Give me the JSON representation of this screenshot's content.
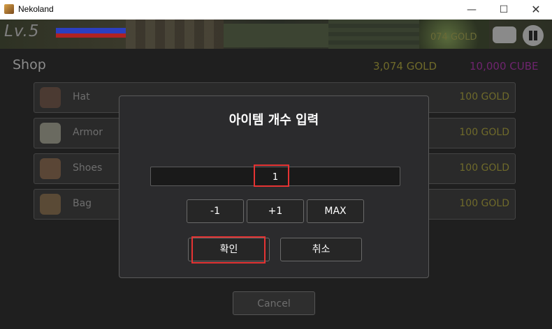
{
  "window": {
    "title": "Nekoland",
    "minimize": "—",
    "maximize": "☐",
    "close": "✕"
  },
  "hud": {
    "level": "Lv.5",
    "gold_partial": "074 GOLD"
  },
  "shop": {
    "title": "Shop",
    "gold": "3,074 GOLD",
    "cube": "10,000 CUBE",
    "items": [
      {
        "name": "Hat",
        "price": "100 GOLD",
        "icon": "hat-icon"
      },
      {
        "name": "Armor",
        "price": "100 GOLD",
        "icon": "armor-icon"
      },
      {
        "name": "Shoes",
        "price": "100 GOLD",
        "icon": "shoes-icon"
      },
      {
        "name": "Bag",
        "price": "100 GOLD",
        "icon": "bag-icon"
      }
    ],
    "cancel_label": "Cancel"
  },
  "dialog": {
    "title": "아이템 개수 입력",
    "quantity": "1",
    "minus_label": "-1",
    "plus_label": "+1",
    "max_label": "MAX",
    "confirm_label": "확인",
    "cancel_label": "취소"
  },
  "colors": {
    "highlight": "#e53333",
    "gold": "#6f6a2a",
    "cube": "#6e246e"
  }
}
